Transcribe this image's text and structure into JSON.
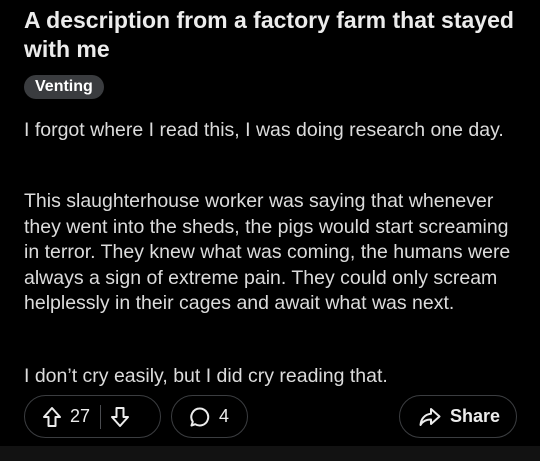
{
  "post": {
    "title": "A description from a factory farm that stayed with me",
    "flair": "Venting",
    "paragraphs": [
      "I forgot where I read this, I was doing research one day.",
      "This slaughterhouse worker was saying that whenever they went into the sheds, the pigs would start screaming in terror.  They knew what was coming, the humans were always a sign of extreme pain.  They could only scream helplessly in their cages and await what was next.",
      "I don’t cry easily, but I did cry reading that."
    ]
  },
  "actions": {
    "upvote_icon": "upvote-arrow-icon",
    "downvote_icon": "downvote-arrow-icon",
    "vote_count": "27",
    "comment_icon": "comment-bubble-icon",
    "comment_count": "4",
    "share_icon": "share-arrow-icon",
    "share_label": "Share"
  },
  "colors": {
    "background": "#000000",
    "text": "#dcdcdc",
    "flair_background": "#3a3c3f",
    "pill_border": "#3b3d40"
  }
}
